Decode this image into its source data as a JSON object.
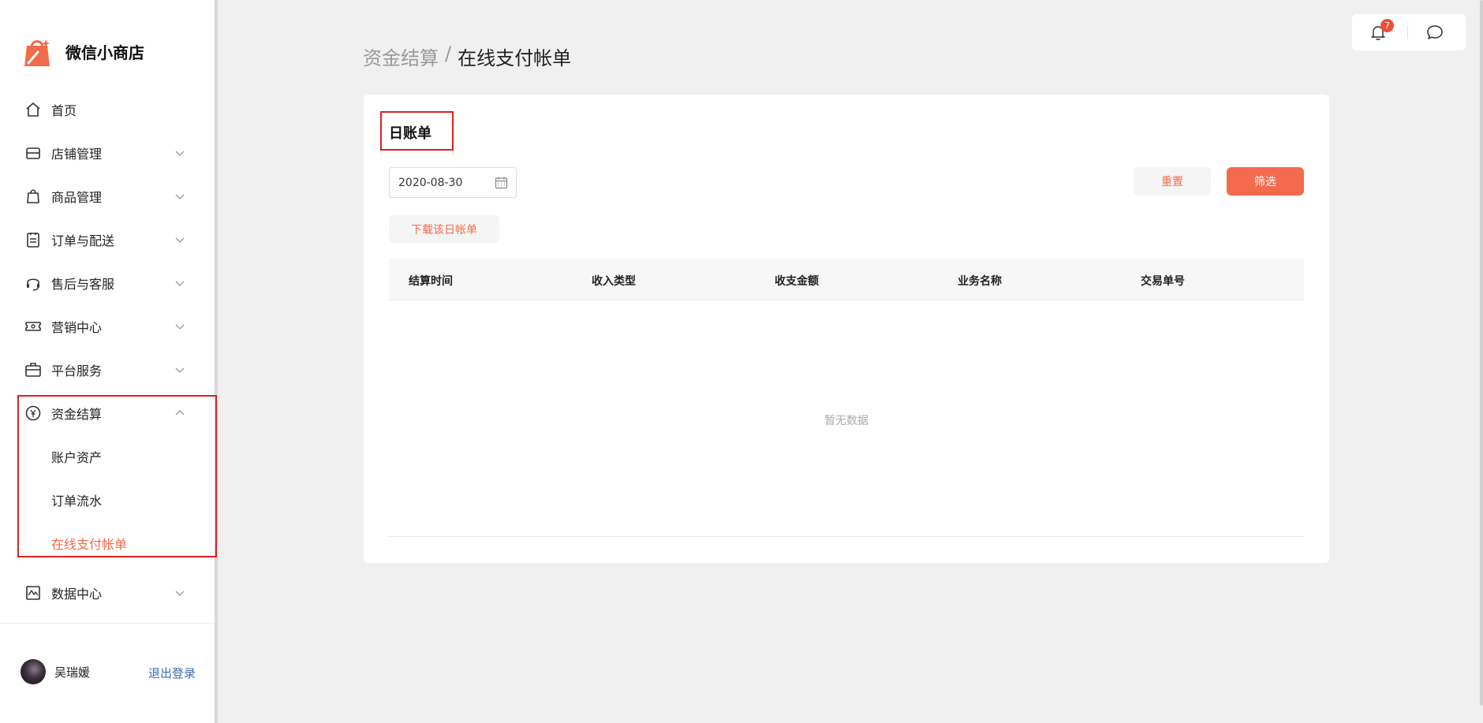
{
  "app": {
    "name": "微信小商店"
  },
  "sidebar": {
    "items": [
      {
        "label": "首页",
        "icon": "home-icon"
      },
      {
        "label": "店铺管理",
        "icon": "store-icon"
      },
      {
        "label": "商品管理",
        "icon": "shopping-bag-icon"
      },
      {
        "label": "订单与配送",
        "icon": "order-clipboard-icon"
      },
      {
        "label": "售后与客服",
        "icon": "headset-icon"
      },
      {
        "label": "营销中心",
        "icon": "ticket-icon"
      },
      {
        "label": "平台服务",
        "icon": "briefcase-icon"
      },
      {
        "label": "资金结算",
        "icon": "yuan-icon",
        "expanded": true
      },
      {
        "label": "数据中心",
        "icon": "chart-icon"
      }
    ],
    "finance_sub": [
      {
        "label": "账户资产"
      },
      {
        "label": "订单流水"
      },
      {
        "label": "在线支付帐单",
        "active": true
      }
    ]
  },
  "user": {
    "name": "吴瑞媛",
    "logout_label": "退出登录"
  },
  "topbar": {
    "notification_count": "7"
  },
  "breadcrumb": {
    "parent": "资金结算",
    "separator": "/",
    "current": "在线支付帐单"
  },
  "card": {
    "title": "日账单",
    "date_value": "2020-08-30",
    "reset_label": "重置",
    "filter_label": "筛选",
    "download_label": "下载该日帐单",
    "columns": [
      "结算时间",
      "收入类型",
      "收支金额",
      "业务名称",
      "交易单号"
    ],
    "empty_text": "暂无数据"
  },
  "colors": {
    "accent": "#f46a4e",
    "highlight": "#e02020",
    "link": "#3b6fb6"
  }
}
